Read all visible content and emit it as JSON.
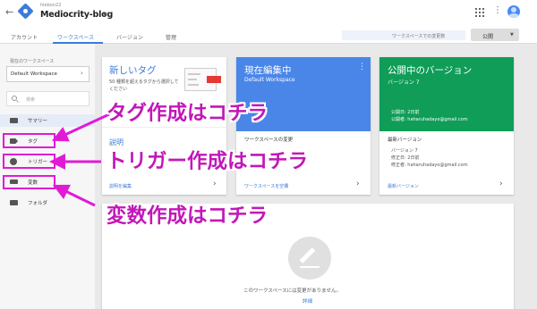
{
  "header": {
    "account": "hiebon22",
    "container_name": "Mediocrity-blog",
    "back_icon": "arrow-back-icon",
    "apps_icon": "apps-grid-icon",
    "more_icon": "more-vert-icon",
    "avatar_icon": "account-avatar-icon"
  },
  "tabs": [
    {
      "label": "アカウント"
    },
    {
      "label": "ワークスペース",
      "active": true
    },
    {
      "label": "バージョン"
    },
    {
      "label": "管理"
    }
  ],
  "workspace_changes_placeholder": "ワークスペースでの変更数",
  "publish_button": "公開",
  "sidebar": {
    "current_ws_label": "現在のワークスペース",
    "current_ws_value": "Default Workspace",
    "search_placeholder": "検索",
    "items": [
      {
        "label": "サマリー",
        "icon": "folder-icon"
      },
      {
        "label": "タグ",
        "icon": "tag-icon"
      },
      {
        "label": "トリガー",
        "icon": "trigger-icon"
      },
      {
        "label": "変数",
        "icon": "variables-icon"
      },
      {
        "label": "フォルダ",
        "icon": "folder-icon"
      }
    ]
  },
  "annotations": {
    "tag": "タグ作成はコチラ",
    "trigger": "トリガー作成はコチラ",
    "variable": "変数作成はコチラ",
    "highlight_color": "#e11ad6",
    "text_color": "#c217b8"
  },
  "cards": {
    "new_tag": {
      "title": "新しいタグ",
      "body": "50 種類を超えるタグから選択してください",
      "subtitle": "説明",
      "link": "説明を編集"
    },
    "current_edit": {
      "title": "現在編集中",
      "subtitle": "Default Workspace",
      "changes": "ワークスペースの変更",
      "link": "ワークスペースを空欄"
    },
    "published": {
      "title": "公開中のバージョン",
      "version": "バージョン 7",
      "published_date": "公開日: 2日前",
      "published_by": "公開者: haharuhadayo@gmail.com",
      "latest_label": "最新バージョン",
      "latest_version": "バージョン 7",
      "modified_date": "修正日: 2日前",
      "modified_by": "修正者: haharuhadayo@gmail.com",
      "link": "最新バージョン"
    }
  },
  "empty_state": {
    "message": "このワークスペースには変更がありません。",
    "link": "詳細"
  },
  "colors": {
    "accent": "#3c7bd9",
    "current_header": "#4a86e8",
    "published_header": "#0f9d58"
  }
}
